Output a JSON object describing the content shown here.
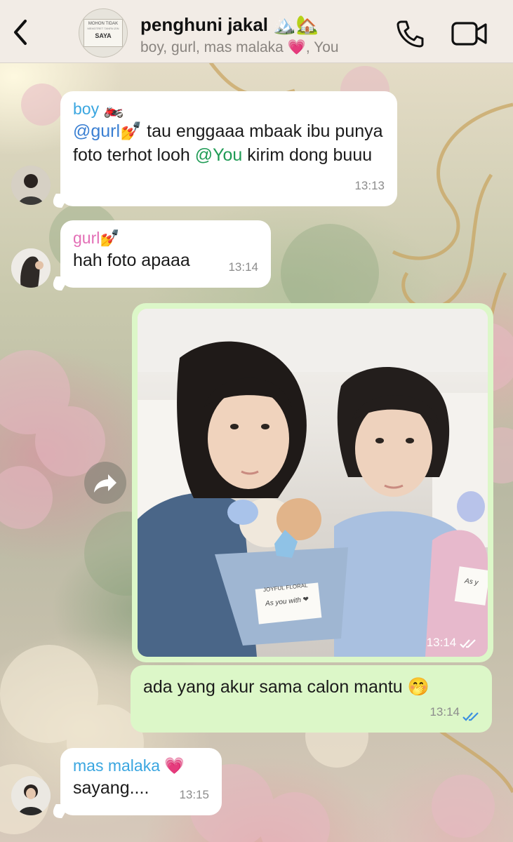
{
  "header": {
    "title": "penghuni jakal 🏔️🏡",
    "members": "boy, gurl, mas malaka 💗, You",
    "avatar_sign": {
      "line1": "MOHON TIDAK",
      "line2": "MEMOTRET TANPA IZIN",
      "line3": "SAYA"
    },
    "icons": {
      "back": "chevron-left-icon",
      "call": "phone-icon",
      "video": "video-camera-icon"
    }
  },
  "messages": [
    {
      "sender": "boy 🏍️",
      "sender_color": "#3aa6e0",
      "parts": [
        "@gurl💅",
        " tau enggaaa mbaak ibu punya foto terhot looh ",
        "@You",
        " kirim dong buuu"
      ],
      "time": "13:13"
    },
    {
      "sender": "gurl💅",
      "sender_color": "#e36fb6",
      "text": "hah foto apaaa",
      "time": "13:14"
    },
    {
      "type": "photo",
      "time": "13:14",
      "status": "read-double-check-icon"
    },
    {
      "text": "ada yang akur sama calon mantu 🤭",
      "time": "13:14",
      "status": "read-double-check-icon"
    },
    {
      "sender": "mas malaka 💗",
      "sender_color": "#3aa6e0",
      "text": "sayang....",
      "time": "13:15"
    }
  ],
  "photo_labels": {
    "card_left_top": "JOYFUL FLORAL",
    "card_left_script": "As you with ❤",
    "card_right_script": "As y"
  },
  "colors": {
    "incoming": "#ffffff",
    "outgoing": "#dcf7c8",
    "header_bg": "#f2ece6",
    "read_tick": "#3b8fe0"
  }
}
